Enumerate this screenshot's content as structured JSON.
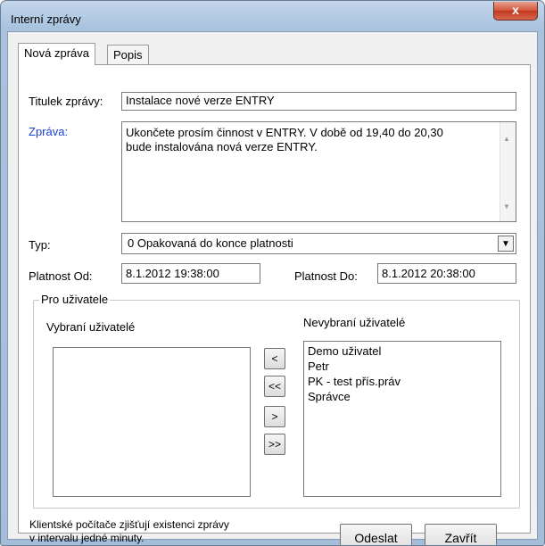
{
  "window": {
    "title": "Interní zprávy",
    "close_label": "x"
  },
  "tabs": [
    {
      "label": "Nová zpráva"
    },
    {
      "label": "Popis"
    }
  ],
  "form": {
    "subject_label": "Titulek zprávy:",
    "subject_value": "Instalace nové verze ENTRY",
    "message_label": "Zpráva:",
    "message_lines": [
      "Ukončete prosím činnost v ENTRY. V době od 19,40 do 20,30",
      "bude instalována nová verze ENTRY."
    ],
    "type_label": "Typ:",
    "type_value": "0  Opakovaná do konce platnosti",
    "valid_from_label": "Platnost Od:",
    "valid_from_value": "8.1.2012 19:38:00",
    "valid_to_label": "Platnost Do:",
    "valid_to_value": "8.1.2012 20:38:00"
  },
  "users": {
    "group_title": "Pro uživatele",
    "selected_label": "Vybraní uživatelé",
    "unselected_label": "Nevybraní uživatelé",
    "selected_items": [],
    "unselected_items": [
      "Demo uživatel",
      "Petr",
      "PK - test přís.práv",
      "Správce"
    ],
    "move_buttons": {
      "add": "<",
      "add_all": "<<",
      "remove": ">",
      "remove_all": ">>"
    }
  },
  "footer": {
    "note_lines": [
      "Klientské počítače zjišťují existenci zprávy",
      "v intervalu jedné minuty."
    ],
    "send_label": "Odeslat",
    "close_label": "Zavřít"
  },
  "colors": {
    "message_label": "#1a3fd6",
    "title_bar": "#a9c3df",
    "close_button": "#c2391f"
  }
}
